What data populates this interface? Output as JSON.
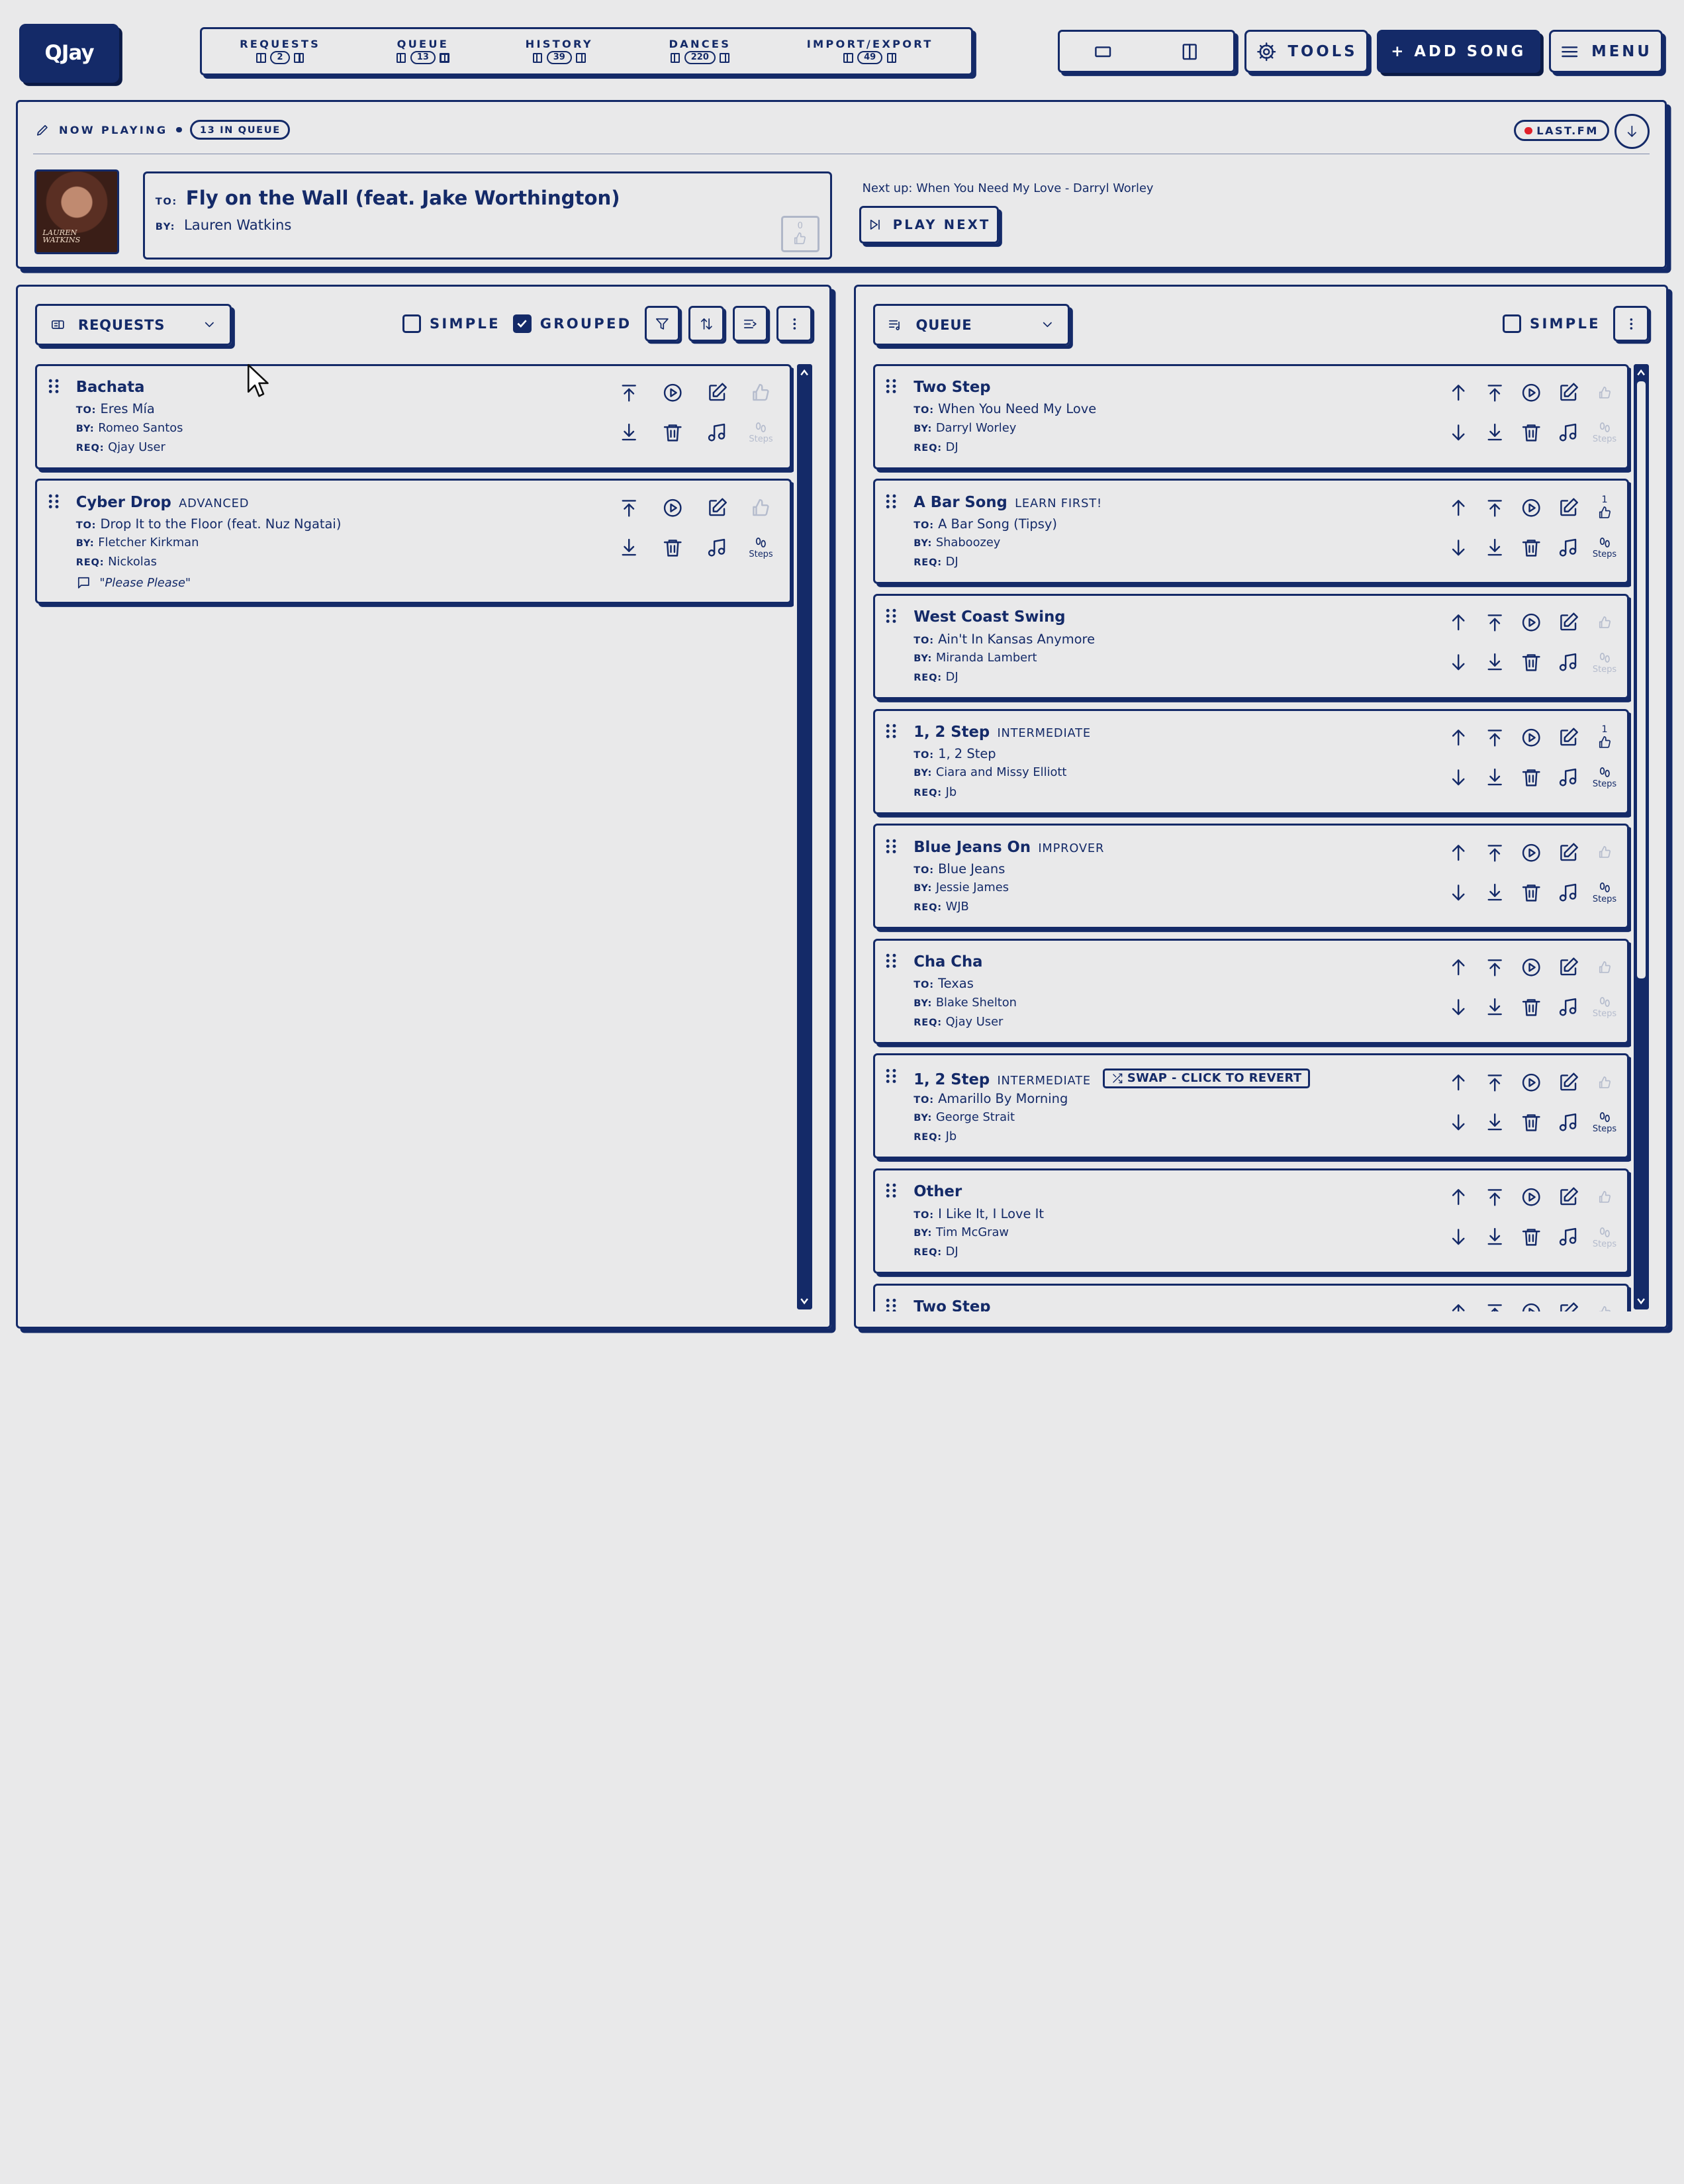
{
  "app": {
    "logo": "QJay"
  },
  "nav": {
    "tabs": [
      {
        "label": "REQUESTS",
        "count": "2"
      },
      {
        "label": "QUEUE",
        "count": "13"
      },
      {
        "label": "HISTORY",
        "count": "39"
      },
      {
        "label": "DANCES",
        "count": "220"
      },
      {
        "label": "IMPORT/EXPORT",
        "count": "49"
      }
    ],
    "tools_label": "TOOLS",
    "add_song_label": "+ ADD SONG",
    "menu_label": "MENU"
  },
  "now_playing": {
    "label": "NOW PLAYING",
    "queue_badge": "13 IN QUEUE",
    "lastfm_label": "LAST.FM",
    "art_caption": "LAUREN WATKINS",
    "to_label": "TO:",
    "by_label": "BY:",
    "title": "Fly on the Wall (feat. Jake Worthington)",
    "artist": "Lauren Watkins",
    "likes": "0",
    "next_up": "Next up: When You Need My Love - Darryl Worley",
    "play_next_label": "PLAY NEXT"
  },
  "requests_panel": {
    "title": "REQUESTS",
    "simple_label": "SIMPLE",
    "grouped_label": "GROUPED",
    "items": [
      {
        "dance": "Bachata",
        "level": "",
        "to": "Eres Mía",
        "by": "Romeo Santos",
        "req": "Qjay User",
        "comment": "",
        "like": "",
        "steps": "Steps"
      },
      {
        "dance": "Cyber Drop",
        "level": "ADVANCED",
        "to": "Drop It to the Floor (feat. Nuz Ngatai)",
        "by": "Fletcher Kirkman",
        "req": "Nickolas",
        "comment": "\"Please Please\"",
        "like": "",
        "steps": "Steps"
      }
    ]
  },
  "queue_panel": {
    "title": "QUEUE",
    "simple_label": "SIMPLE",
    "items": [
      {
        "dance": "Two Step",
        "level": "",
        "swap": "",
        "to": "When You Need My Love",
        "by": "Darryl Worley",
        "req": "DJ",
        "like": "",
        "steps": "Steps"
      },
      {
        "dance": "A Bar Song",
        "level": "LEARN FIRST!",
        "swap": "",
        "to": "A Bar Song (Tipsy)",
        "by": "Shaboozey",
        "req": "DJ",
        "like": "1",
        "steps": "Steps"
      },
      {
        "dance": "West Coast Swing",
        "level": "",
        "swap": "",
        "to": "Ain't In Kansas Anymore",
        "by": "Miranda Lambert",
        "req": "DJ",
        "like": "",
        "steps": "Steps"
      },
      {
        "dance": "1, 2 Step",
        "level": "INTERMEDIATE",
        "swap": "",
        "to": "1, 2 Step",
        "by": "Ciara and Missy Elliott",
        "req": "Jb",
        "like": "1",
        "steps": "Steps"
      },
      {
        "dance": "Blue Jeans On",
        "level": "IMPROVER",
        "swap": "",
        "to": "Blue Jeans",
        "by": "Jessie James",
        "req": "WJB",
        "like": "",
        "steps": "Steps"
      },
      {
        "dance": "Cha Cha",
        "level": "",
        "swap": "",
        "to": "Texas",
        "by": "Blake Shelton",
        "req": "Qjay User",
        "like": "",
        "steps": "Steps"
      },
      {
        "dance": "1, 2 Step",
        "level": "INTERMEDIATE",
        "swap": "SWAP - CLICK TO REVERT",
        "to": "Amarillo By Morning",
        "by": "George Strait",
        "req": "Jb",
        "like": "",
        "steps": "Steps"
      },
      {
        "dance": "Other",
        "level": "",
        "swap": "",
        "to": "I Like It, I Love It",
        "by": "Tim McGraw",
        "req": "DJ",
        "like": "",
        "steps": "Steps"
      },
      {
        "dance": "Two Step",
        "level": "",
        "swap": "",
        "to": "",
        "by": "",
        "req": "",
        "like": "",
        "steps": ""
      }
    ]
  },
  "labels": {
    "to": "TO:",
    "by": "BY:",
    "req": "REQ:"
  },
  "colors": {
    "primary": "#142a68",
    "background": "#e9e9ea",
    "faded": "#b5bccd",
    "live": "#e0202a"
  }
}
